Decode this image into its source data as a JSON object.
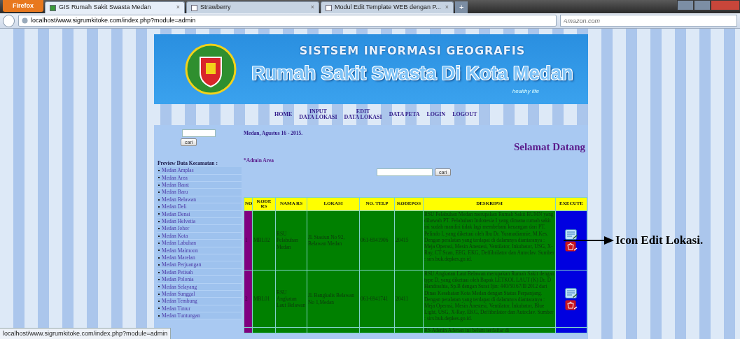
{
  "browser": {
    "app_menu": "Firefox",
    "new_tab": "+",
    "address": "localhost/www.sigrumkitoke.com/index.php?module=admin",
    "search_placeholder": "Amazon.com",
    "tabs": [
      {
        "title": "GIS Rumah Sakit Swasta Medan",
        "close": "×",
        "selected": true
      },
      {
        "title": "Strawberry",
        "close": "×",
        "selected": false
      },
      {
        "title": "Modul Edit Template WEB dengan P...",
        "close": "×",
        "selected": false
      }
    ]
  },
  "banner": {
    "subtitle": "SISTSEM INFORMASI GEOGRAFIS",
    "title": "Rumah Sakit Swasta Di Kota Medan",
    "tagline": "healthy life"
  },
  "nav": [
    {
      "lines": [
        "HOME"
      ]
    },
    {
      "lines": [
        "INPUT",
        "DATA LOKASI"
      ]
    },
    {
      "lines": [
        "EDIT",
        "DATA LOKASI"
      ]
    },
    {
      "lines": [
        "DATA PETA"
      ]
    },
    {
      "lines": [
        "LOGIN"
      ]
    },
    {
      "lines": [
        "LOGOUT"
      ]
    }
  ],
  "sidebar": {
    "search_button": "cari",
    "heading": "Preview Data Kecamatan :",
    "items": [
      "Medan Amplas",
      "Medan Area",
      "Medan Barat",
      "Medan Baru",
      "Medan Belawan",
      "Medan Deli",
      "Medan Denai",
      "Medan Helvetia",
      "Medan Johor",
      "Medan Kota",
      "Medan Labuhan",
      "Medan Maimoon",
      "Medan Marelan",
      "Medan Perjuangan",
      "Medan Petisah",
      "Medan Polonia",
      "Medan Selayang",
      "Medan Sunggal",
      "Medan Tembung",
      "Medan Timur",
      "Medan Tuntungan"
    ]
  },
  "main": {
    "date": "Medan, Agustus 16 - 2015.",
    "welcome": "Selamat Datang",
    "area": "*Admin Area",
    "search_button": "cari",
    "table": {
      "columns": [
        "NO",
        "KODE RS",
        "NAMA RS",
        "LOKASI",
        "NO. TELP",
        "KODEPOS",
        "DESKRIPSI",
        "EXECUTE"
      ],
      "rows": [
        {
          "no": "1",
          "kode": "MBL02",
          "nama": "RSU Pelabuhan Medan",
          "lokasi": "Jl. Stasiun No 92, Belawan Medan",
          "telp": "061-6941906",
          "kodepos": "20415",
          "deskripsi": "RSU Pelabuhan Medan merupakan Rumah Sakit BUMN yang dibawah PT. Pelabuhan Indonesia I yang dimana rumah sakit ini sudah mandiri tidak lagi membebani keuangan dari PT. Pelindo I, yang diketuai oleh Ibu Dr. Yusmadiannie, M.Kes. Dengan peralatan yang terdapat di dalamnya diantaranya : Meja Operasi, Mesin Anestesi, Ventilator, Inkubator, USG, X-Ray, CT Scan, EEG, EKG, Deffibrilator dan Autoclav. Sumber : sirs.buk.depkes.go.id."
        },
        {
          "no": "2",
          "kode": "MBL01",
          "nama": "RSU Angkatan Laut Belawan",
          "lokasi": "Jl. Bangkalis Belawan No 1,Medan",
          "telp": "061-6941741",
          "kodepos": "20411",
          "deskripsi": "RSU Angkatan Laut Belawan merupakan Rumah Sakit dengan type D, yang diketuai oleh Bapak LETKOL LAUT (K) Dr. D Handrashta, Sp.B dengan Surat Ijin: 440/50.67/II/2012 dari Dinas Kesehatan Kota Medan dengan Status Perpanjang. Dengan peralatan yang terdapat di dalamnya diantaranya : Meja Operasi, Mesin Anestesi, Ventilator, Inkubator, Blue Light, USG, X-Ray, EKG, Deffibrilator dan Autoclav. Sumber : sirs.buk.depkes.go.id."
        },
        {
          "no": "",
          "kode": "",
          "nama": "",
          "lokasi": "",
          "telp": "",
          "kodepos": "",
          "deskripsi": "RS Adenin Adenan ini belum terdaftar di"
        }
      ]
    }
  },
  "annotation": {
    "text": "Icon Edit Lokasi."
  },
  "status_bar": "localhost/www.sigrumkitoke.com/index.php?module=admin"
}
